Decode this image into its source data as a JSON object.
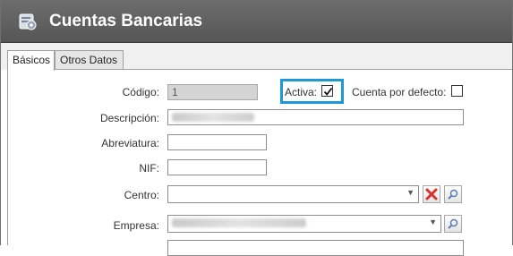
{
  "window": {
    "title": "Cuentas Bancarias"
  },
  "tabs": [
    {
      "label": "Básicos",
      "active": true
    },
    {
      "label": "Otros Datos",
      "active": false
    }
  ],
  "form": {
    "codigo": {
      "label": "Código:",
      "value": "1"
    },
    "activa": {
      "label": "Activa:",
      "checked": true
    },
    "cuenta_defecto": {
      "label": "Cuenta por defecto:",
      "checked": false
    },
    "descripcion": {
      "label": "Descripción:"
    },
    "abreviatura": {
      "label": "Abreviatura:",
      "value": ""
    },
    "nif": {
      "label": "NIF:",
      "value": ""
    },
    "centro": {
      "label": "Centro:",
      "value": ""
    },
    "empresa": {
      "label": "Empresa:"
    }
  },
  "colors": {
    "titlebar": "#5e5e5e",
    "highlight": "#1d9ad6",
    "delete_red": "#d9322b"
  }
}
